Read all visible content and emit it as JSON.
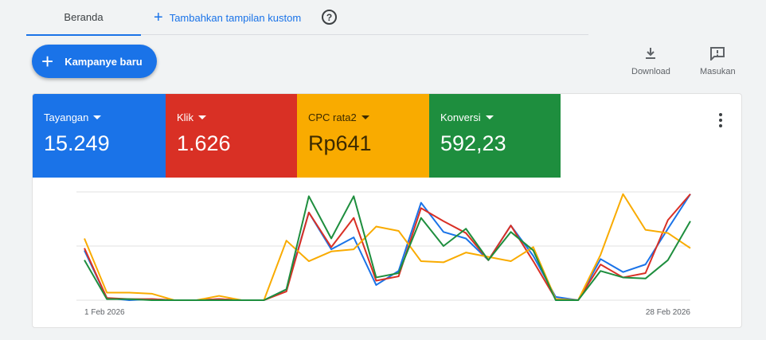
{
  "tabs": {
    "home": "Beranda",
    "add_custom": "Tambahkan tampilan kustom",
    "help_icon": "help-circle-icon"
  },
  "toolbar": {
    "new_campaign": "Kampanye baru",
    "download": "Download",
    "feedback": "Masukan"
  },
  "metrics": [
    {
      "label": "Tayangan",
      "value": "15.249",
      "color": "#1a73e8"
    },
    {
      "label": "Klik",
      "value": "1.626",
      "color": "#d93025"
    },
    {
      "label": "CPC rata2",
      "value": "Rp641",
      "color": "#f9ab00"
    },
    {
      "label": "Konversi",
      "value": "592,23",
      "color": "#1e8e3e"
    }
  ],
  "chart_data": {
    "type": "line",
    "x_start": "1 Feb 2026",
    "x_end": "28 Feb 2026",
    "x_tick_labels": [
      "1 Feb 2026",
      "28 Feb 2026"
    ],
    "ylim": [
      0,
      100
    ],
    "grid": true,
    "y_axis_labels": "none (normalized per-metric)",
    "series": [
      {
        "name": "Tayangan",
        "color": "#1a73e8",
        "values": [
          46,
          2,
          0,
          1,
          0,
          0,
          1,
          0,
          0,
          10,
          81,
          47,
          58,
          14,
          27,
          90,
          63,
          57,
          37,
          69,
          41,
          3,
          0,
          38,
          26,
          33,
          66,
          98
        ]
      },
      {
        "name": "Klik",
        "color": "#d93025",
        "values": [
          48,
          2,
          1,
          1,
          0,
          0,
          1,
          0,
          0,
          8,
          81,
          49,
          76,
          18,
          22,
          85,
          73,
          62,
          37,
          69,
          36,
          1,
          0,
          33,
          21,
          25,
          74,
          98
        ]
      },
      {
        "name": "CPC rata2",
        "color": "#f9ab00",
        "values": [
          57,
          7,
          7,
          6,
          0,
          0,
          4,
          0,
          0,
          55,
          36,
          45,
          47,
          68,
          64,
          36,
          35,
          44,
          40,
          36,
          49,
          1,
          0,
          42,
          98,
          65,
          62,
          48
        ]
      },
      {
        "name": "Konversi",
        "color": "#1e8e3e",
        "values": [
          37,
          1,
          1,
          0,
          0,
          0,
          0,
          0,
          0,
          10,
          96,
          57,
          96,
          21,
          25,
          76,
          50,
          66,
          37,
          63,
          46,
          0,
          0,
          27,
          21,
          20,
          37,
          73
        ]
      }
    ]
  }
}
